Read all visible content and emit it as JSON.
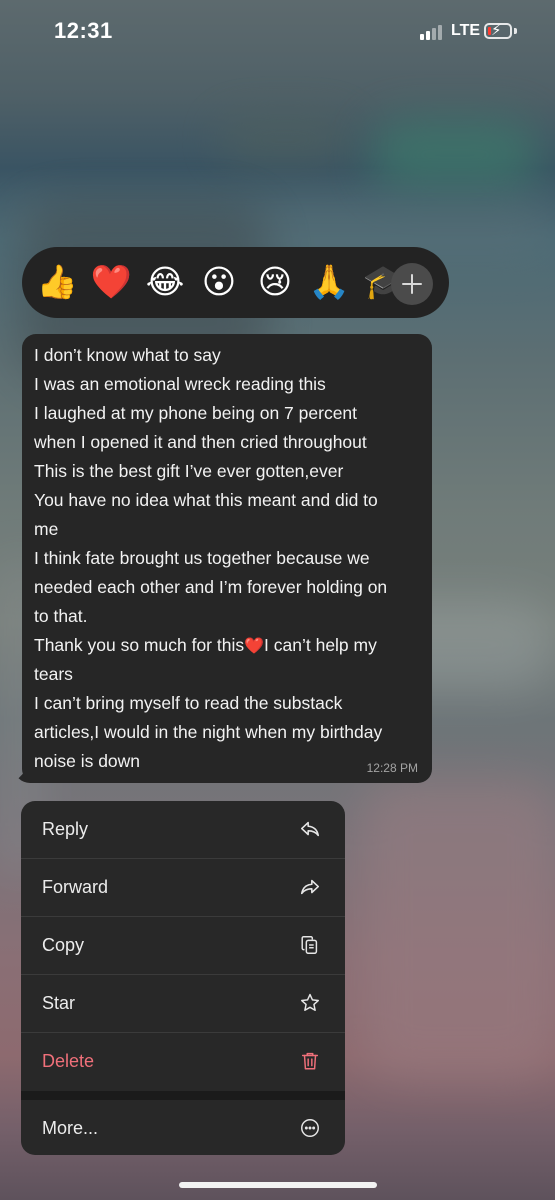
{
  "status_bar": {
    "time": "12:31",
    "network": "LTE",
    "battery_level": 0.07,
    "battery_color": "#ff3b30"
  },
  "reactions": {
    "emojis": [
      "👍",
      "❤️",
      "😂",
      "😮",
      "😢",
      "🙏",
      "🎓"
    ],
    "more_icon": "plus-icon"
  },
  "message": {
    "lines": [
      "I don’t know what to say",
      "I was an emotional wreck reading this",
      "I laughed at my phone being on 7 percent",
      "when I opened it and then cried throughout",
      "This is the best gift I’ve ever gotten,ever",
      "You have no idea what this meant and did to",
      "me",
      "I think fate brought us together because we",
      "needed each other and I’m forever holding on",
      "to that.",
      "Thank you so much for this",
      "❤️",
      "I can’t help my",
      "tears",
      "I can’t bring myself to read the substack",
      "articles,I would in the night when my birthday",
      "noise is down"
    ],
    "time": "12:28 PM"
  },
  "menu": {
    "items": [
      {
        "label": "Reply",
        "icon": "reply-icon"
      },
      {
        "label": "Forward",
        "icon": "forward-icon"
      },
      {
        "label": "Copy",
        "icon": "copy-icon"
      },
      {
        "label": "Star",
        "icon": "star-icon"
      },
      {
        "label": "Delete",
        "icon": "trash-icon",
        "color": "#f0707a"
      },
      {
        "label": "More...",
        "icon": "more-icon"
      }
    ]
  }
}
